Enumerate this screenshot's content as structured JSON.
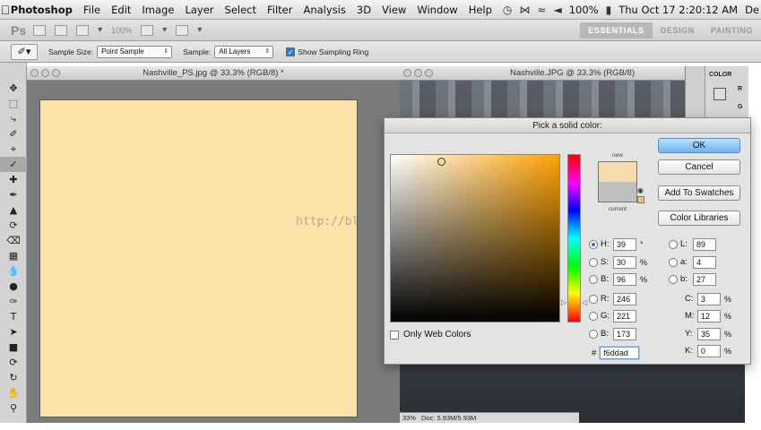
{
  "menubar": {
    "app": "Photoshop",
    "menus": [
      "File",
      "Edit",
      "Image",
      "Layer",
      "Select",
      "Filter",
      "Analysis",
      "3D",
      "View",
      "Window",
      "Help"
    ],
    "battery": "100%",
    "clock": "Thu Oct 17  2:20:12 AM",
    "user": "De"
  },
  "appbar": {
    "logo": "Ps",
    "zoom": "100%",
    "workspaces": [
      "ESSENTIALS",
      "DESIGN",
      "PAINTING"
    ]
  },
  "options": {
    "sample_size_label": "Sample Size:",
    "sample_size_value": "Point Sample",
    "sample_label": "Sample:",
    "sample_value": "All Layers",
    "sampling_ring_label": "Show Sampling Ring"
  },
  "documents": {
    "doc1_title": "Nashville_PS.jpg @ 33.3% (RGB/8) *",
    "doc2_title": "Nashville.JPG @ 33.3% (RGB/8)",
    "doc2_status_zoom": "33%",
    "doc2_status_doc": "Doc: 5.93M/5.93M"
  },
  "color_panel": {
    "tab": "COLOR",
    "r": "R",
    "g": "G"
  },
  "watermark": "http://blog.csdn.net/",
  "picker": {
    "title": "Pick a solid color:",
    "new_label": "new",
    "current_label": "current",
    "buttons": {
      "ok": "OK",
      "cancel": "Cancel",
      "add_swatches": "Add To Swatches",
      "libraries": "Color Libraries"
    },
    "hsb": {
      "h_label": "H:",
      "h": "39",
      "h_unit": "°",
      "s_label": "S:",
      "s": "30",
      "s_unit": "%",
      "b_label": "B:",
      "b": "96",
      "b_unit": "%"
    },
    "rgb": {
      "r_label": "R:",
      "r": "246",
      "g_label": "G:",
      "g": "221",
      "b_label": "B:",
      "b": "173"
    },
    "lab": {
      "l_label": "L:",
      "l": "89",
      "a_label": "a:",
      "a": "4",
      "b_label": "b:",
      "b": "27"
    },
    "cmyk": {
      "c_label": "C:",
      "c": "3",
      "c_unit": "%",
      "m_label": "M:",
      "m": "12",
      "m_unit": "%",
      "y_label": "Y:",
      "y": "35",
      "y_unit": "%",
      "k_label": "K:",
      "k": "0",
      "k_unit": "%"
    },
    "web_colors_label": "Only Web Colors",
    "hex_label": "#",
    "hex": "f6ddad",
    "new_color": "#f6ddad",
    "current_color": "#bfbfbf"
  },
  "canvas_color": "#fde2aa"
}
